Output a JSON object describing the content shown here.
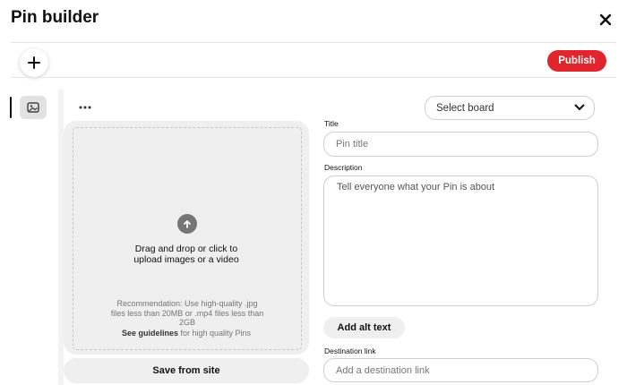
{
  "header": {
    "title": "Pin builder",
    "close_icon": "close-icon"
  },
  "toolbar": {
    "add_icon": "plus-icon",
    "publish_label": "Publish"
  },
  "colors": {
    "publish": "#e1252c",
    "surface": "#efefef",
    "text": "#111111",
    "muted": "#767676"
  },
  "sidebar": {
    "items": [
      {
        "icon": "image-icon",
        "selected": true
      }
    ]
  },
  "editor": {
    "more_icon": "more-icon",
    "board_select": {
      "value": "Select board",
      "icon": "chevron-down-icon"
    },
    "upload": {
      "icon": "arrow-up-icon",
      "line1": "Drag and drop or click to",
      "line2": "upload images or a video",
      "recommendation_line1": "Recommendation: Use high-quality .jpg",
      "recommendation_line2": "files less than 20MB or .mp4 files less than",
      "recommendation_line3": "2GB",
      "guidelines_link": "See guidelines",
      "guidelines_suffix": "for high quality Pins"
    },
    "save_from_site_label": "Save from site",
    "title_field": {
      "label": "Title",
      "placeholder": "Pin title"
    },
    "description_field": {
      "label": "Description",
      "placeholder": "Tell everyone what your Pin is about"
    },
    "alt_text_label": "Add alt text",
    "destination_field": {
      "label": "Destination link",
      "placeholder": "Add a destination link"
    }
  }
}
